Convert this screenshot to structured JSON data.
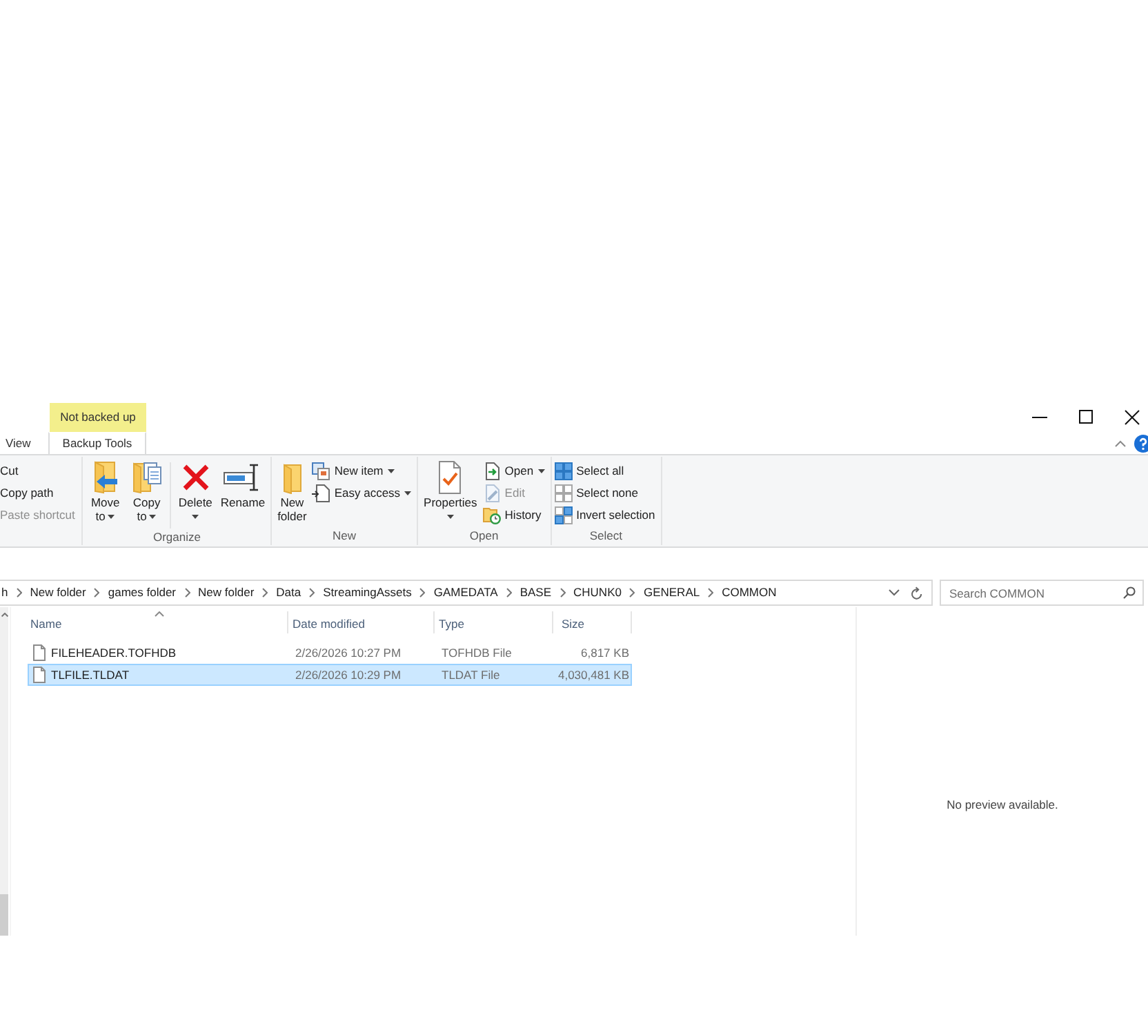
{
  "context_tab": {
    "label": "Not backed up"
  },
  "ribbon_tabs": [
    {
      "label": "View",
      "selected": false
    },
    {
      "label": "Backup Tools",
      "selected": true
    }
  ],
  "ribbon_groups": [
    {
      "sections": [
        [
          {
            "kind": "small",
            "label": "Cut",
            "dropdown": false,
            "disabled": false
          },
          {
            "kind": "small",
            "label": "Copy path",
            "dropdown": false,
            "disabled": false
          },
          {
            "kind": "small",
            "label": "Paste shortcut",
            "dropdown": false,
            "disabled": true
          }
        ]
      ]
    },
    {
      "label": "Organize",
      "sections": [
        [
          {
            "kind": "large",
            "lines": [
              "Move",
              "to"
            ],
            "dropdown": true
          },
          {
            "kind": "large",
            "lines": [
              "Copy",
              "to"
            ],
            "dropdown": true
          }
        ],
        [
          {
            "kind": "large",
            "lines": [
              "Delete"
            ],
            "dropdown": true
          },
          {
            "kind": "large",
            "lines": [
              "Rename"
            ],
            "dropdown": false
          }
        ]
      ]
    },
    {
      "label": "New",
      "sections": [
        [
          {
            "kind": "large",
            "lines": [
              "New",
              "folder"
            ],
            "dropdown": false
          },
          {
            "kind": "small",
            "label": "New item",
            "dropdown": true,
            "disabled": false
          },
          {
            "kind": "small",
            "label": "Easy access",
            "dropdown": true,
            "disabled": false
          }
        ]
      ]
    },
    {
      "label": "Open",
      "sections": [
        [
          {
            "kind": "large",
            "lines": [
              "Properties"
            ],
            "dropdown": true
          },
          {
            "kind": "small",
            "label": "Open",
            "dropdown": true,
            "disabled": false
          },
          {
            "kind": "small",
            "label": "Edit",
            "dropdown": false,
            "disabled": true
          },
          {
            "kind": "small",
            "label": "History",
            "dropdown": false,
            "disabled": false
          }
        ]
      ]
    },
    {
      "label": "Select",
      "sections": [
        [
          {
            "kind": "small",
            "label": "Select all",
            "dropdown": false,
            "disabled": false
          },
          {
            "kind": "small",
            "label": "Select none",
            "dropdown": false,
            "disabled": false
          },
          {
            "kind": "small",
            "label": "Invert selection",
            "dropdown": false,
            "disabled": false
          }
        ]
      ]
    }
  ],
  "address_bar": {
    "breadcrumbs": [
      "h",
      "New folder",
      "games folder",
      "New folder",
      "Data",
      "StreamingAssets",
      "GAMEDATA",
      "BASE",
      "CHUNK0",
      "GENERAL",
      "COMMON"
    ]
  },
  "search": {
    "placeholder": "Search COMMON"
  },
  "file_list": {
    "columns": [
      {
        "label": "Name",
        "sorted": true
      },
      {
        "label": "Date modified",
        "sorted": false
      },
      {
        "label": "Type",
        "sorted": false
      },
      {
        "label": "Size",
        "sorted": false
      }
    ],
    "rows": [
      {
        "name": "FILEHEADER.TOFHDB",
        "date_modified": "2/26/2026 10:27 PM",
        "type": "TOFHDB File",
        "size": "6,817 KB",
        "selected": false
      },
      {
        "name": "TLFILE.TLDAT",
        "date_modified": "2/26/2026 10:29 PM",
        "type": "TLDAT File",
        "size": "4,030,481 KB",
        "selected": true
      }
    ]
  },
  "preview": {
    "message": "No preview available."
  }
}
